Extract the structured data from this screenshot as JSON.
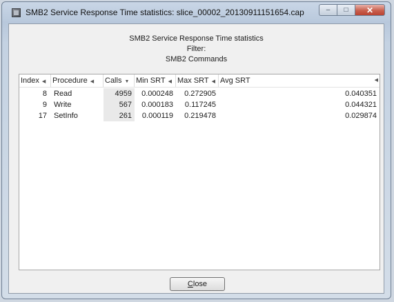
{
  "window": {
    "title": "SMB2 Service Response Time statistics: slice_00002_20130911151654.cap",
    "icons": {
      "app": "app-icon",
      "minimize": "minimize-icon",
      "maximize": "maximize-icon",
      "close": "close-icon"
    }
  },
  "header": {
    "line1": "SMB2 Service Response Time statistics",
    "line2": "Filter:",
    "line3": "SMB2 Commands"
  },
  "table": {
    "columns": [
      "Index",
      "Procedure",
      "Calls",
      "Min SRT",
      "Max SRT",
      "Avg SRT"
    ],
    "sort_column": "Calls",
    "rows": [
      {
        "index": "8",
        "procedure": "Read",
        "calls": "4959",
        "min": "0.000248",
        "max": "0.272905",
        "avg": "0.040351"
      },
      {
        "index": "9",
        "procedure": "Write",
        "calls": "567",
        "min": "0.000183",
        "max": "0.117245",
        "avg": "0.044321"
      },
      {
        "index": "17",
        "procedure": "SetInfo",
        "calls": "261",
        "min": "0.000119",
        "max": "0.219478",
        "avg": "0.029874"
      }
    ]
  },
  "buttons": {
    "close_first": "C",
    "close_rest": "lose"
  }
}
